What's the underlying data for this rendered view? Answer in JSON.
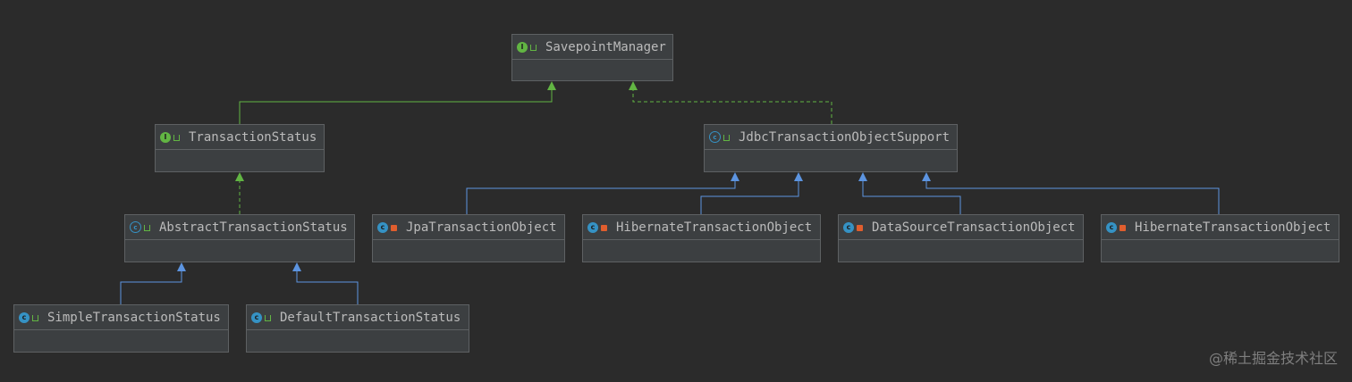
{
  "nodes": {
    "savepoint_manager": "SavepointManager",
    "transaction_status": "TransactionStatus",
    "jdbc_transaction_object_support": "JdbcTransactionObjectSupport",
    "abstract_transaction_status": "AbstractTransactionStatus",
    "jpa_transaction_object": "JpaTransactionObject",
    "hibernate_transaction_object_1": "HibernateTransactionObject",
    "datasource_transaction_object": "DataSourceTransactionObject",
    "hibernate_transaction_object_2": "HibernateTransactionObject",
    "simple_transaction_status": "SimpleTransactionStatus",
    "default_transaction_status": "DefaultTransactionStatus"
  },
  "kind_letters": {
    "interface": "I",
    "class": "c",
    "abstract": "c"
  },
  "watermark": "@稀土掘金技术社区",
  "colors": {
    "background": "#2b2b2b",
    "node_fill": "#3c3f41",
    "interface_icon": "#62b543",
    "class_icon": "#3592c4",
    "implements_edge": "#62b543",
    "extends_edge": "#5c94e0",
    "private_lock": "#e05e2e"
  }
}
